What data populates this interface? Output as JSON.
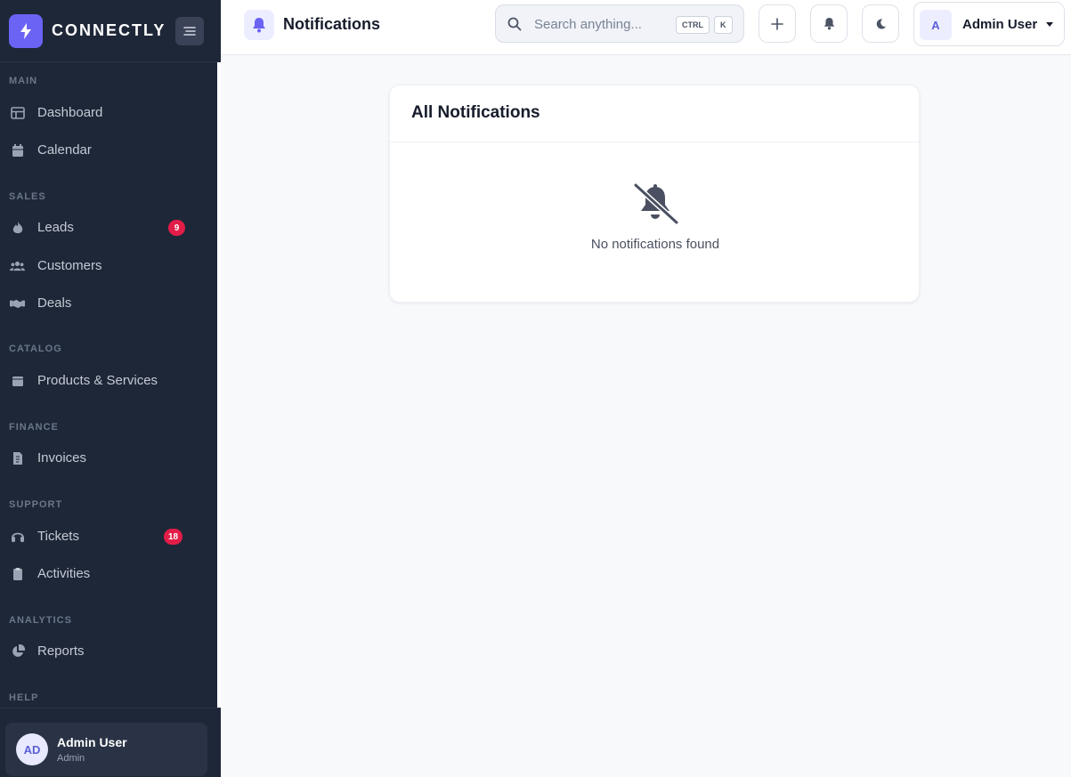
{
  "brand": {
    "name": "CONNECTLY",
    "logo_icon": "bolt-icon",
    "accent": "#6b63f4"
  },
  "sidebar": {
    "sections": [
      {
        "label": "MAIN",
        "items": [
          {
            "label": "Dashboard",
            "icon": "grid-icon"
          },
          {
            "label": "Calendar",
            "icon": "calendar-icon"
          }
        ]
      },
      {
        "label": "SALES",
        "items": [
          {
            "label": "Leads",
            "icon": "fire-icon",
            "badge": "9"
          },
          {
            "label": "Customers",
            "icon": "users-icon"
          },
          {
            "label": "Deals",
            "icon": "handshake-icon"
          }
        ]
      },
      {
        "label": "CATALOG",
        "items": [
          {
            "label": "Products & Services",
            "icon": "box-icon"
          }
        ]
      },
      {
        "label": "FINANCE",
        "items": [
          {
            "label": "Invoices",
            "icon": "invoice-icon"
          }
        ]
      },
      {
        "label": "SUPPORT",
        "items": [
          {
            "label": "Tickets",
            "icon": "headset-icon",
            "badge": "18"
          },
          {
            "label": "Activities",
            "icon": "clipboard-icon"
          }
        ]
      },
      {
        "label": "ANALYTICS",
        "items": [
          {
            "label": "Reports",
            "icon": "pie-chart-icon"
          }
        ]
      },
      {
        "label": "HELP",
        "items": []
      }
    ],
    "user": {
      "initials": "AD",
      "name": "Admin User",
      "role": "Admin"
    }
  },
  "header": {
    "title": "Notifications",
    "search": {
      "placeholder": "Search anything...",
      "shortcut_keys": [
        "CTRL",
        "K"
      ]
    },
    "profile": {
      "initial": "A",
      "name": "Admin User"
    }
  },
  "main": {
    "card_title": "All Notifications",
    "empty_message": "No notifications found",
    "empty_icon": "bell-slash-icon"
  },
  "colors": {
    "badge": "#e11d48",
    "sidebar_bg": "#1e2738"
  }
}
